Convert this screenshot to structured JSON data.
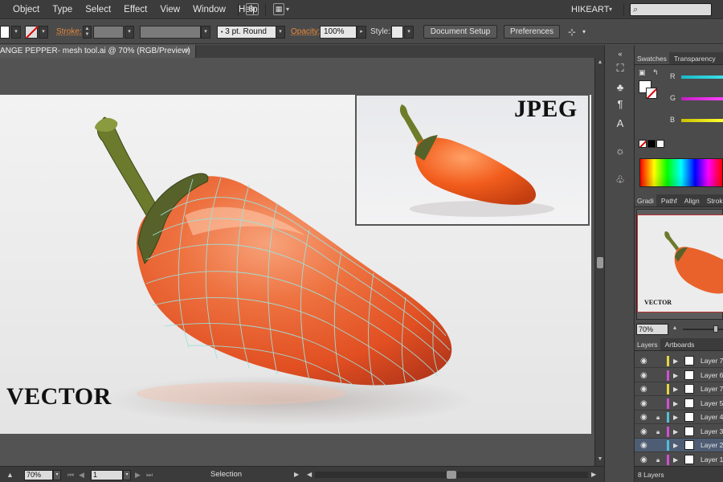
{
  "menubar": {
    "items": [
      "Object",
      "Type",
      "Select",
      "Effect",
      "View",
      "Window",
      "Help"
    ],
    "bridge_icon": "Br",
    "workspace": "HIKEART",
    "search_placeholder": ""
  },
  "controlbar": {
    "stroke_label": "Stroke:",
    "brush_value": "3 pt. Round",
    "opacity_label": "Opacity:",
    "opacity_value": "100%",
    "style_label": "Style:",
    "document_setup": "Document Setup",
    "preferences": "Preferences"
  },
  "document": {
    "tab_title": "ANGE PEPPER- mesh tool.ai @ 70% (RGB/Preview)",
    "close": "×"
  },
  "artwork": {
    "jpeg_label": "JPEG",
    "vector_label": "VECTOR",
    "colors": {
      "pepper_orange": "#e9622c",
      "pepper_highlight": "#f8a57a",
      "stem_green": "#6b7a2c",
      "mesh_line": "#9fe0dc"
    }
  },
  "tools": [
    "artboard-tool-icon",
    "symbol-sprayer-icon",
    "paragraph-icon",
    "vertical-type-icon",
    "sun-icon",
    "club-icon"
  ],
  "panels": {
    "top_tabs": [
      "Swatches",
      "Transparency"
    ],
    "rgb": {
      "r": "R",
      "g": "G",
      "b": "B"
    },
    "mid_tabs": [
      "Gradi",
      "Pathf",
      "Align",
      "Strok"
    ],
    "navigator_label": "VECTOR",
    "zoom": "70%",
    "layer_tabs": [
      "Layers",
      "Artboards"
    ],
    "layers": [
      {
        "name": "Layer 7",
        "color": "#e8d440",
        "locked": false,
        "selected": false
      },
      {
        "name": "Layer 6",
        "color": "#d050d0",
        "locked": false,
        "selected": false
      },
      {
        "name": "Layer 7",
        "color": "#e8d440",
        "locked": false,
        "selected": false
      },
      {
        "name": "Layer 5",
        "color": "#d050d0",
        "locked": false,
        "selected": false
      },
      {
        "name": "Layer 4",
        "color": "#50c0d8",
        "locked": true,
        "selected": false
      },
      {
        "name": "Layer 3",
        "color": "#d050d0",
        "locked": true,
        "selected": false
      },
      {
        "name": "Layer 2",
        "color": "#50c0d8",
        "locked": false,
        "selected": true
      },
      {
        "name": "Layer 1",
        "color": "#d050d0",
        "locked": true,
        "selected": false
      }
    ],
    "layer_count": "8 Layers"
  },
  "statusbar": {
    "zoom": "70%",
    "artboard": "1",
    "tool": "Selection"
  }
}
